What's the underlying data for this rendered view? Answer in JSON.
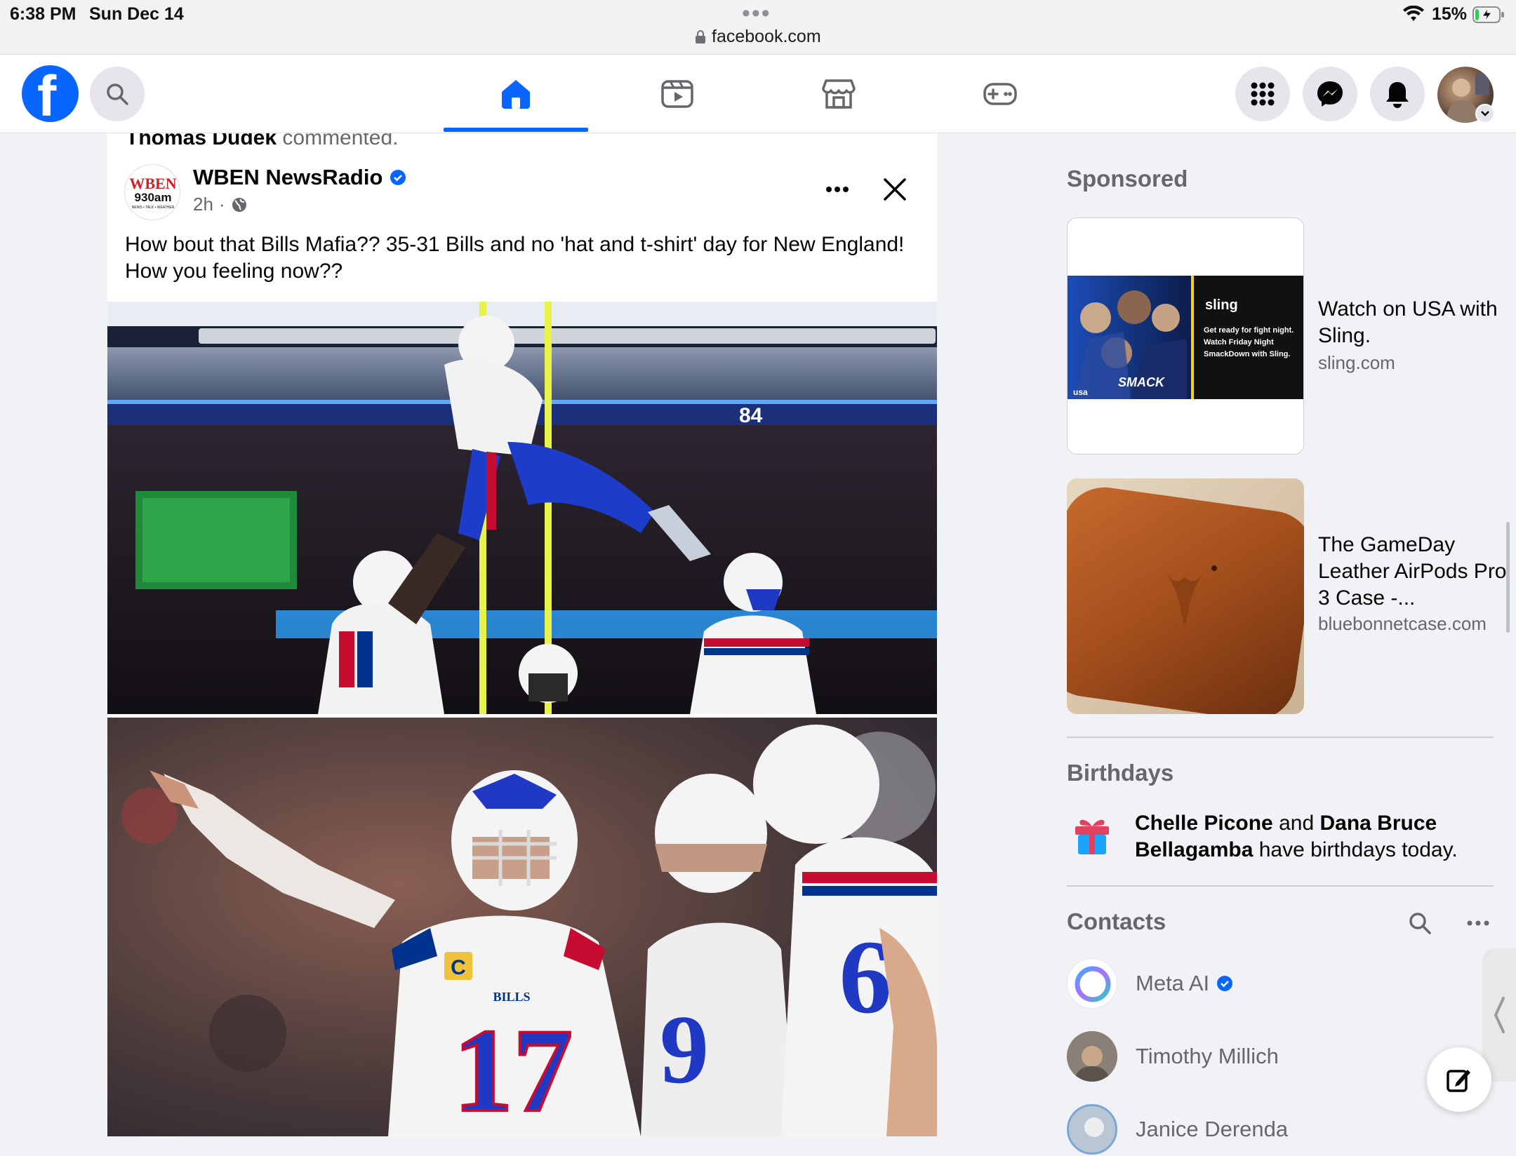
{
  "status_bar": {
    "time": "6:38 PM",
    "date": "Sun Dec 14",
    "url": "facebook.com",
    "battery": "15%",
    "battery_level": 0.15
  },
  "nav": {
    "active_tab": "home",
    "tabs": [
      "home",
      "video",
      "marketplace",
      "gaming"
    ],
    "icons": [
      "facebook-logo",
      "search-icon",
      "home-icon",
      "video-icon",
      "marketplace-icon",
      "gaming-icon",
      "menu-grid-icon",
      "messenger-icon",
      "bell-icon"
    ]
  },
  "feed": {
    "activity_actor": "Thomas Dudek",
    "activity_verb": "commented.",
    "post": {
      "author": "WBEN NewsRadio",
      "verified": true,
      "time": "2h",
      "audience": "public",
      "avatar_text": "WBEN",
      "avatar_sub": "930am",
      "avatar_tagline": "NEWS • TALK • WEATHER",
      "text": "How bout that Bills Mafia??   35-31 Bills and no 'hat and t-shirt' day for New England! How you feeling now??",
      "photo1_jersey": "84",
      "photo2_jersey": "17",
      "photo2_jersey_b": "9",
      "photo2_jersey_c": "6",
      "photo_team_label": "BILLS",
      "captain_patch": "C"
    }
  },
  "rail": {
    "sponsored_title": "Sponsored",
    "ads": [
      {
        "title": "Watch on USA with Sling.",
        "domain": "sling.com",
        "img_brand": "sling",
        "img_text": "Get ready for fight night. Watch Friday Night SmackDown with Sling.",
        "img_logo": "SMACK",
        "img_network": "usa"
      },
      {
        "title": "The GameDay Leather AirPods Pro 3 Case -...",
        "domain": "bluebonnetcase.com"
      }
    ],
    "birthdays_title": "Birthdays",
    "birthday_name_1": "Chelle Picone",
    "birthday_and": " and ",
    "birthday_name_2": "Dana Bruce Bellagamba",
    "birthday_suffix": " have birthdays today.",
    "contacts_title": "Contacts",
    "contacts": [
      {
        "name": "Meta AI",
        "verified": true
      },
      {
        "name": "Timothy Millich"
      },
      {
        "name": "Janice Derenda"
      }
    ]
  },
  "colors": {
    "fb_blue": "#0866ff",
    "bills_blue": "#00338d",
    "bills_red": "#c60c30"
  }
}
